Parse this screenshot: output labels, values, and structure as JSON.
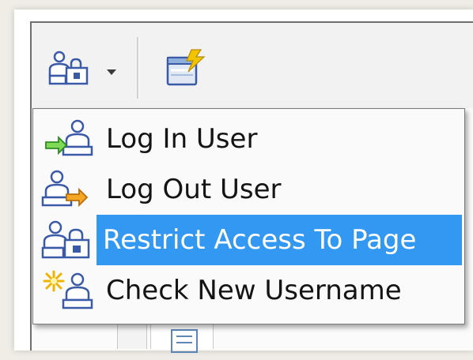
{
  "menu": {
    "items": [
      {
        "label": "Log In User",
        "icon": "log-in-user-icon",
        "selected": false
      },
      {
        "label": "Log Out User",
        "icon": "log-out-user-icon",
        "selected": false
      },
      {
        "label": "Restrict Access To Page",
        "icon": "restrict-access-icon",
        "selected": true
      },
      {
        "label": "Check New Username",
        "icon": "check-new-username-icon",
        "selected": false
      }
    ]
  },
  "toolbar": {
    "buttons": [
      {
        "icon": "user-authentication-icon"
      },
      {
        "icon": "chevron-down-icon"
      },
      {
        "icon": "insert-server-behavior-icon"
      }
    ]
  },
  "colors": {
    "highlight": "#3298f2",
    "highlight_text": "#ffffff",
    "menu_bg": "#fafafa",
    "icon_blue": "#3a5aa8"
  }
}
